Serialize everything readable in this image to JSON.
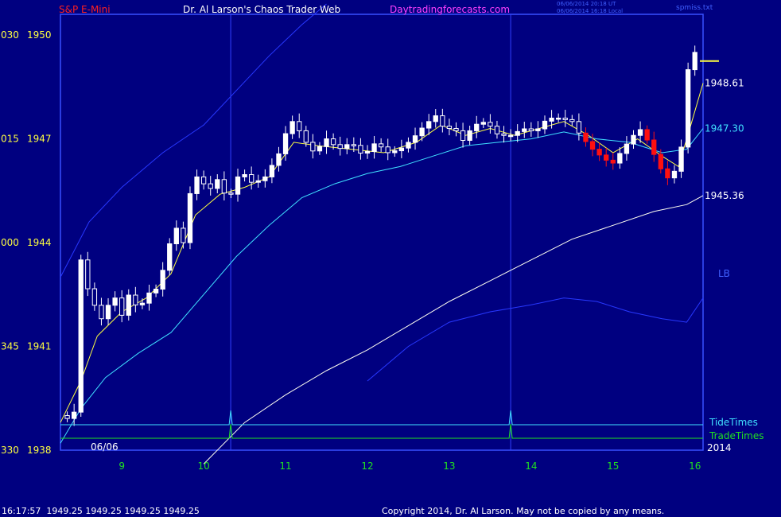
{
  "header": {
    "instrument": "S&P E-Mini",
    "title": "Dr. Al Larson's Chaos Trader Web",
    "site": "Daytradingforecasts.com",
    "timestamp_utc": "06/06/2014 20:18 UT",
    "timestamp_local": "06/06/2014 16:18 Local",
    "data_file": "spmiss.txt",
    "instrument_color": "#ff2020",
    "title_color": "#ffffff",
    "site_color": "#ff40ff"
  },
  "footer": {
    "quote": "16:17:57  1949.25 1949.25 1949.25 1949.25",
    "copyright": "Copyright 2014, Dr. Al Larson. May not be copied by any means."
  },
  "chart_data": {
    "type": "candlestick",
    "session_date": "06/06",
    "year": "2014",
    "x_ticks": [
      9,
      10,
      11,
      12,
      13,
      14,
      15,
      16
    ],
    "x_range": [
      8.25,
      16.1
    ],
    "y_range": [
      1938,
      1950.6
    ],
    "y_ticks": [
      {
        "value": 1938,
        "price": "1938",
        "left": "330"
      },
      {
        "value": 1941,
        "price": "1941",
        "left": "345"
      },
      {
        "value": 1944,
        "price": "1944",
        "left": "000"
      },
      {
        "value": 1947,
        "price": "1947",
        "left": "015"
      },
      {
        "value": 1950,
        "price": "1950",
        "left": "030"
      }
    ],
    "time_markers": [
      10.33,
      13.75
    ],
    "annotations": [
      {
        "text": "1948.61",
        "value": 1948.61,
        "color": "#ffffff"
      },
      {
        "text": "1947.30",
        "value": 1947.3,
        "color": "#40e0ff"
      },
      {
        "text": "1945.36",
        "value": 1945.36,
        "color": "#ffffff"
      },
      {
        "text": "LB",
        "value": 1943.1,
        "color": "#4060ff"
      }
    ],
    "panels": [
      {
        "name": "TideTimes",
        "color": "#40e0ff",
        "peaks": [
          10.33,
          13.75
        ]
      },
      {
        "name": "TradeTimes",
        "color": "#20e020",
        "peaks": [
          10.33,
          13.75
        ]
      }
    ],
    "last_price": 1949.25,
    "price_path": [
      [
        8.25,
        1939.0
      ],
      [
        8.35,
        1938.9
      ],
      [
        8.45,
        1939.2
      ],
      [
        8.5,
        1943.5
      ],
      [
        8.6,
        1942.5
      ],
      [
        8.75,
        1941.8
      ],
      [
        8.9,
        1942.5
      ],
      [
        9.0,
        1941.9
      ],
      [
        9.1,
        1942.6
      ],
      [
        9.2,
        1942.0
      ],
      [
        9.3,
        1942.5
      ],
      [
        9.45,
        1942.7
      ],
      [
        9.55,
        1943.7
      ],
      [
        9.65,
        1944.5
      ],
      [
        9.75,
        1944.0
      ],
      [
        9.85,
        1945.7
      ],
      [
        9.95,
        1946.0
      ],
      [
        10.05,
        1945.4
      ],
      [
        10.15,
        1945.9
      ],
      [
        10.3,
        1945.2
      ],
      [
        10.45,
        1946.1
      ],
      [
        10.6,
        1945.7
      ],
      [
        10.75,
        1945.9
      ],
      [
        10.85,
        1946.3
      ],
      [
        10.95,
        1946.7
      ],
      [
        11.05,
        1947.6
      ],
      [
        11.15,
        1947.3
      ],
      [
        11.25,
        1946.9
      ],
      [
        11.35,
        1946.6
      ],
      [
        11.5,
        1947.0
      ],
      [
        11.65,
        1946.7
      ],
      [
        11.8,
        1946.9
      ],
      [
        11.95,
        1946.5
      ],
      [
        12.1,
        1946.9
      ],
      [
        12.25,
        1946.6
      ],
      [
        12.4,
        1946.7
      ],
      [
        12.55,
        1947.0
      ],
      [
        12.7,
        1947.4
      ],
      [
        12.85,
        1947.7
      ],
      [
        12.95,
        1947.2
      ],
      [
        13.05,
        1947.4
      ],
      [
        13.15,
        1946.9
      ],
      [
        13.3,
        1947.4
      ],
      [
        13.45,
        1947.5
      ],
      [
        13.6,
        1947.1
      ],
      [
        13.75,
        1947.1
      ],
      [
        13.9,
        1947.3
      ],
      [
        14.05,
        1947.2
      ],
      [
        14.2,
        1947.6
      ],
      [
        14.35,
        1947.6
      ],
      [
        14.5,
        1947.5
      ],
      [
        14.6,
        1947.1
      ],
      [
        14.75,
        1946.7
      ],
      [
        14.9,
        1946.4
      ],
      [
        15.0,
        1946.3
      ],
      [
        15.15,
        1946.8
      ],
      [
        15.25,
        1947.1
      ],
      [
        15.35,
        1947.3
      ],
      [
        15.45,
        1946.8
      ],
      [
        15.55,
        1946.3
      ],
      [
        15.65,
        1945.8
      ],
      [
        15.72,
        1946.1
      ],
      [
        15.8,
        1946.0
      ],
      [
        15.87,
        1947.6
      ],
      [
        15.93,
        1949.4
      ],
      [
        16.0,
        1949.5
      ],
      [
        16.1,
        1949.25
      ]
    ],
    "overlays": [
      {
        "name": "fast",
        "color": "#ffff40",
        "points": [
          [
            8.25,
            1938.8
          ],
          [
            8.5,
            1940.0
          ],
          [
            8.7,
            1941.3
          ],
          [
            9.0,
            1942.0
          ],
          [
            9.3,
            1942.4
          ],
          [
            9.6,
            1943.1
          ],
          [
            9.9,
            1944.8
          ],
          [
            10.2,
            1945.4
          ],
          [
            10.5,
            1945.6
          ],
          [
            10.8,
            1945.9
          ],
          [
            11.1,
            1946.9
          ],
          [
            11.4,
            1946.8
          ],
          [
            11.8,
            1946.7
          ],
          [
            12.2,
            1946.6
          ],
          [
            12.6,
            1946.9
          ],
          [
            12.9,
            1947.4
          ],
          [
            13.2,
            1947.1
          ],
          [
            13.5,
            1947.3
          ],
          [
            13.8,
            1947.1
          ],
          [
            14.1,
            1947.3
          ],
          [
            14.4,
            1947.5
          ],
          [
            14.7,
            1947.1
          ],
          [
            15.0,
            1946.6
          ],
          [
            15.3,
            1947.0
          ],
          [
            15.6,
            1946.5
          ],
          [
            15.8,
            1946.2
          ],
          [
            15.95,
            1947.4
          ],
          [
            16.1,
            1948.61
          ]
        ]
      },
      {
        "name": "medium",
        "color": "#40e0ff",
        "points": [
          [
            8.25,
            1938.2
          ],
          [
            8.5,
            1939.2
          ],
          [
            8.8,
            1940.1
          ],
          [
            9.2,
            1940.8
          ],
          [
            9.6,
            1941.4
          ],
          [
            10.0,
            1942.5
          ],
          [
            10.4,
            1943.6
          ],
          [
            10.8,
            1944.5
          ],
          [
            11.2,
            1945.3
          ],
          [
            11.6,
            1945.7
          ],
          [
            12.0,
            1946.0
          ],
          [
            12.4,
            1946.2
          ],
          [
            12.8,
            1946.5
          ],
          [
            13.2,
            1946.8
          ],
          [
            13.6,
            1946.9
          ],
          [
            14.0,
            1947.0
          ],
          [
            14.4,
            1947.2
          ],
          [
            14.8,
            1947.0
          ],
          [
            15.2,
            1946.9
          ],
          [
            15.6,
            1946.6
          ],
          [
            15.9,
            1946.7
          ],
          [
            16.1,
            1947.3
          ]
        ]
      },
      {
        "name": "slow",
        "color": "#fffff0",
        "points": [
          [
            10.0,
            1937.6
          ],
          [
            10.5,
            1938.8
          ],
          [
            11.0,
            1939.6
          ],
          [
            11.5,
            1940.3
          ],
          [
            12.0,
            1940.9
          ],
          [
            12.5,
            1941.6
          ],
          [
            13.0,
            1942.3
          ],
          [
            13.5,
            1942.9
          ],
          [
            14.0,
            1943.5
          ],
          [
            14.5,
            1944.1
          ],
          [
            15.0,
            1944.5
          ],
          [
            15.5,
            1944.9
          ],
          [
            15.9,
            1945.1
          ],
          [
            16.1,
            1945.36
          ]
        ]
      },
      {
        "name": "upper band",
        "color": "#2838ff",
        "points": [
          [
            8.25,
            1943.0
          ],
          [
            8.6,
            1944.6
          ],
          [
            9.0,
            1945.6
          ],
          [
            9.5,
            1946.6
          ],
          [
            10.0,
            1947.4
          ],
          [
            10.4,
            1948.4
          ],
          [
            10.8,
            1949.4
          ],
          [
            11.2,
            1950.3
          ],
          [
            11.5,
            1950.9
          ]
        ]
      },
      {
        "name": "lower band",
        "color": "#2838ff",
        "points": [
          [
            12.0,
            1940.0
          ],
          [
            12.5,
            1941.0
          ],
          [
            13.0,
            1941.7
          ],
          [
            13.5,
            1942.0
          ],
          [
            14.0,
            1942.2
          ],
          [
            14.4,
            1942.4
          ],
          [
            14.8,
            1942.3
          ],
          [
            15.2,
            1942.0
          ],
          [
            15.6,
            1941.8
          ],
          [
            15.9,
            1941.7
          ],
          [
            16.1,
            1942.4
          ]
        ]
      }
    ]
  }
}
